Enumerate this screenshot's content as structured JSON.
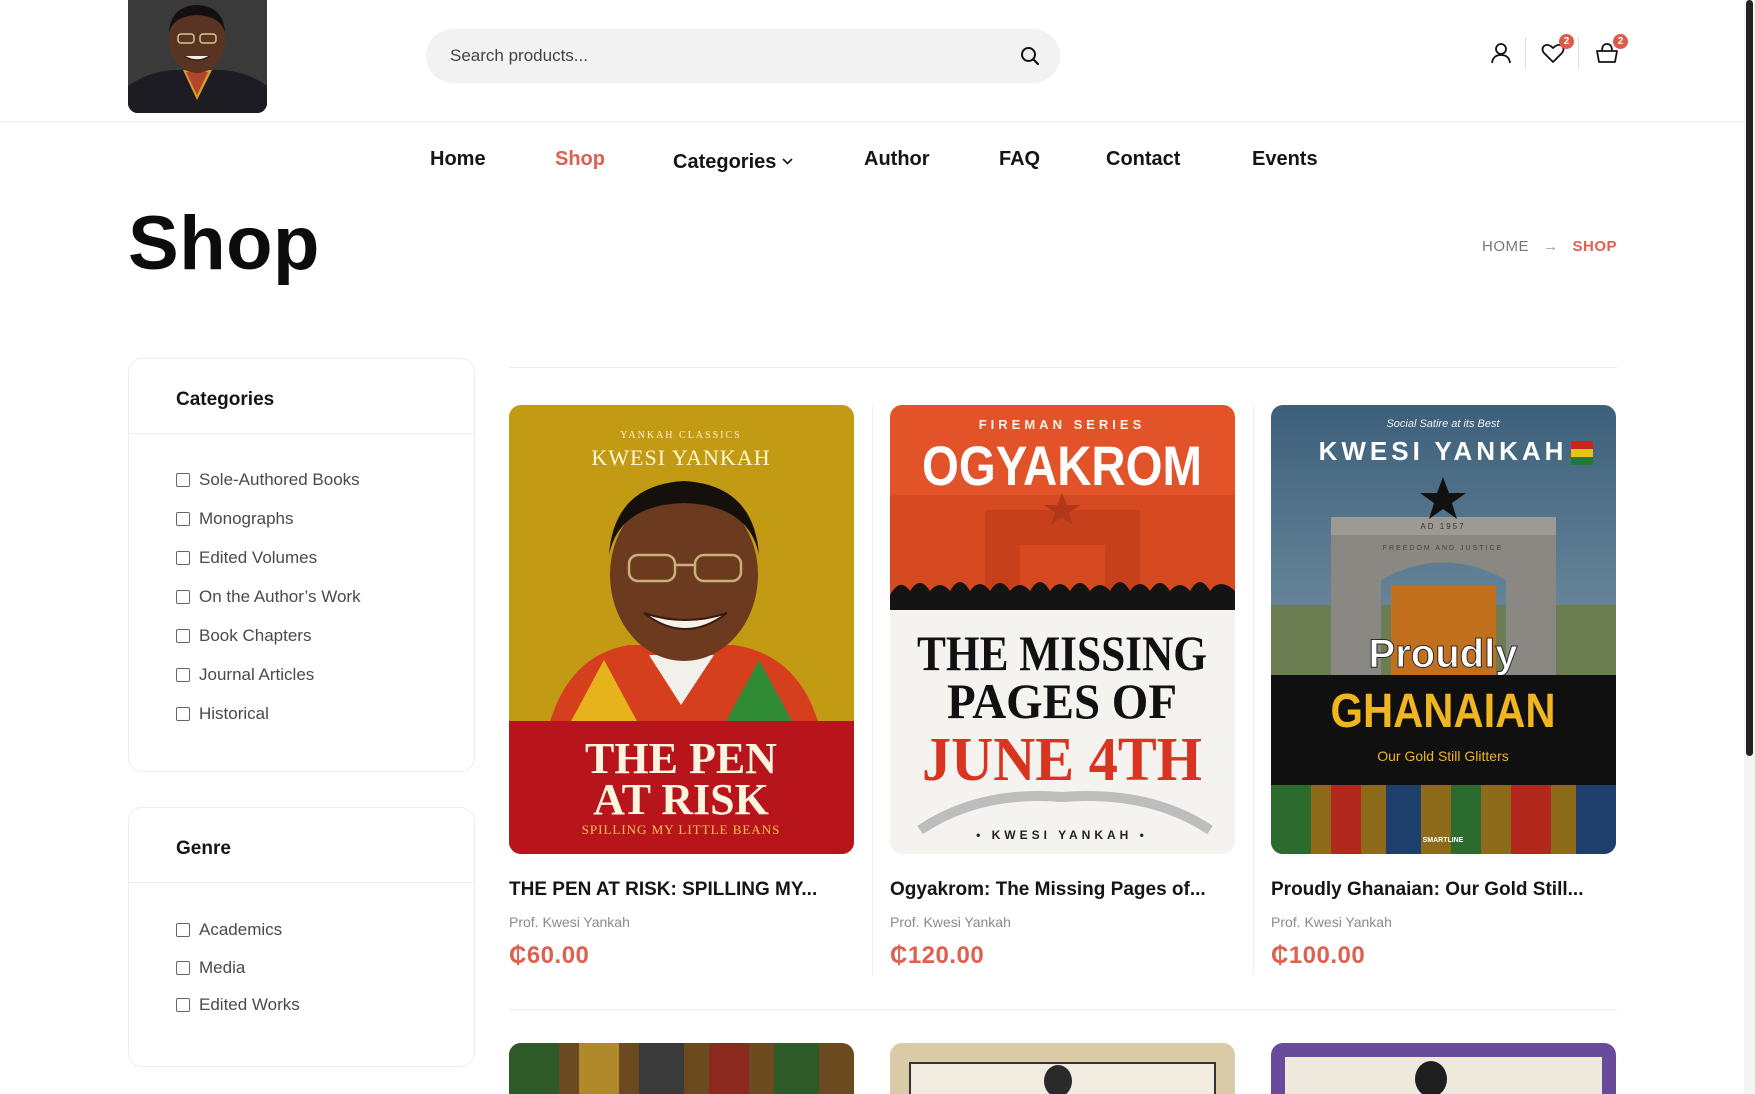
{
  "header": {
    "search": {
      "placeholder": "Search products..."
    },
    "wishlist_count": "2",
    "cart_count": "2"
  },
  "nav": {
    "items": [
      {
        "label": "Home",
        "active": false
      },
      {
        "label": "Shop",
        "active": true
      },
      {
        "label": "Categories",
        "active": false,
        "has_dropdown": true
      },
      {
        "label": "Author",
        "active": false
      },
      {
        "label": "FAQ",
        "active": false
      },
      {
        "label": "Contact",
        "active": false
      },
      {
        "label": "Events",
        "active": false
      }
    ]
  },
  "page": {
    "title": "Shop",
    "breadcrumb": {
      "home": "HOME",
      "current": "SHOP"
    }
  },
  "filters": {
    "categories": {
      "title": "Categories",
      "items": [
        "Sole-Authored Books",
        "Monographs",
        "Edited Volumes",
        "On the Author’s Work",
        "Book Chapters",
        "Journal Articles",
        "Historical"
      ]
    },
    "genre": {
      "title": "Genre",
      "items": [
        "Academics",
        "Media",
        "Edited Works"
      ]
    }
  },
  "products": [
    {
      "title": "THE PEN AT RISK: SPILLING MY...",
      "author": "Prof. Kwesi Yankah",
      "price": "₵60.00",
      "cover": {
        "series": "YANKAH CLASSICS",
        "author": "KWESI YANKAH",
        "title_1": "THE PEN",
        "title_2": "AT RISK",
        "subtitle": "SPILLING MY LITTLE BEANS"
      }
    },
    {
      "title": "Ogyakrom: The Missing Pages of...",
      "author": "Prof. Kwesi Yankah",
      "price": "₵120.00",
      "cover": {
        "series": "FIREMAN SERIES",
        "title_main": "OGYAKROM",
        "title_1": "THE MISSING",
        "title_2": "PAGES OF",
        "title_3": "JUNE 4TH",
        "author": "• KWESI YANKAH •"
      }
    },
    {
      "title": "Proudly Ghanaian: Our Gold Still...",
      "author": "Prof. Kwesi Yankah",
      "price": "₵100.00",
      "cover": {
        "tagline": "Social Satire at its Best",
        "author": "KWESI YANKAH",
        "arch_text_1": "AD 1957",
        "arch_text_2": "FREEDOM AND JUSTICE",
        "title_1": "Proudly",
        "title_2": "GHANAIAN",
        "subtitle": "Our Gold Still Glitters",
        "publisher": "SMARTLINE"
      }
    }
  ],
  "colors": {
    "accent": "#e0604f",
    "text_dark": "#151515",
    "muted": "#8a8a8a"
  }
}
